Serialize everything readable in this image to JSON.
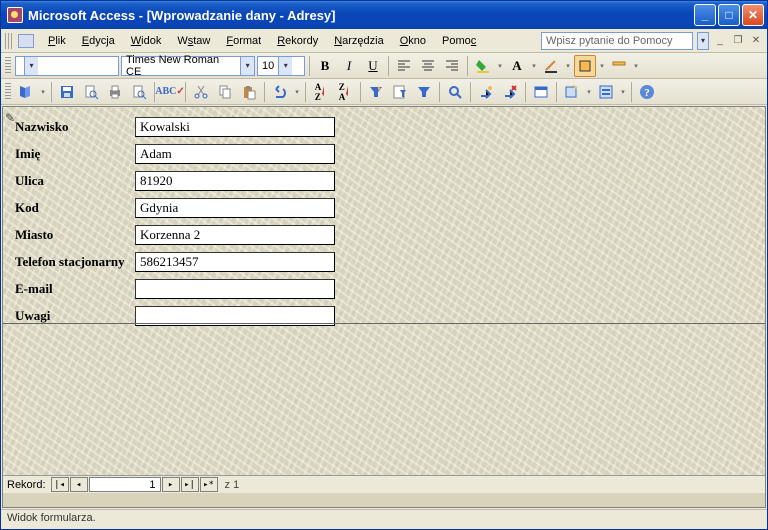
{
  "title": "Microsoft Access - [Wprowadzanie dany - Adresy]",
  "menu": {
    "plik": "Plik",
    "edycja": "Edycja",
    "widok": "Widok",
    "wstaw": "Wstaw",
    "format": "Format",
    "rekordy": "Rekordy",
    "narzedzia": "Narzędzia",
    "okno": "Okno",
    "pomoc": "Pomoc"
  },
  "ask_placeholder": "Wpisz pytanie do Pomocy",
  "font_name": "Times New Roman CE",
  "font_size": "10",
  "labels": {
    "nazwisko": "Nazwisko",
    "imie": "Imię",
    "ulica": "Ulica",
    "kod": "Kod",
    "miasto": "Miasto",
    "telefon": "Telefon stacjonarny",
    "email": "E-mail",
    "uwagi": "Uwagi"
  },
  "values": {
    "nazwisko": "Kowalski",
    "imie": "Adam",
    "ulica": "81920",
    "kod": "Gdynia",
    "miasto": "Korzenna 2",
    "telefon": "586213457",
    "email": "",
    "uwagi": ""
  },
  "record": {
    "label": "Rekord:",
    "num": "1",
    "of": "z  1"
  },
  "status": "Widok formularza."
}
